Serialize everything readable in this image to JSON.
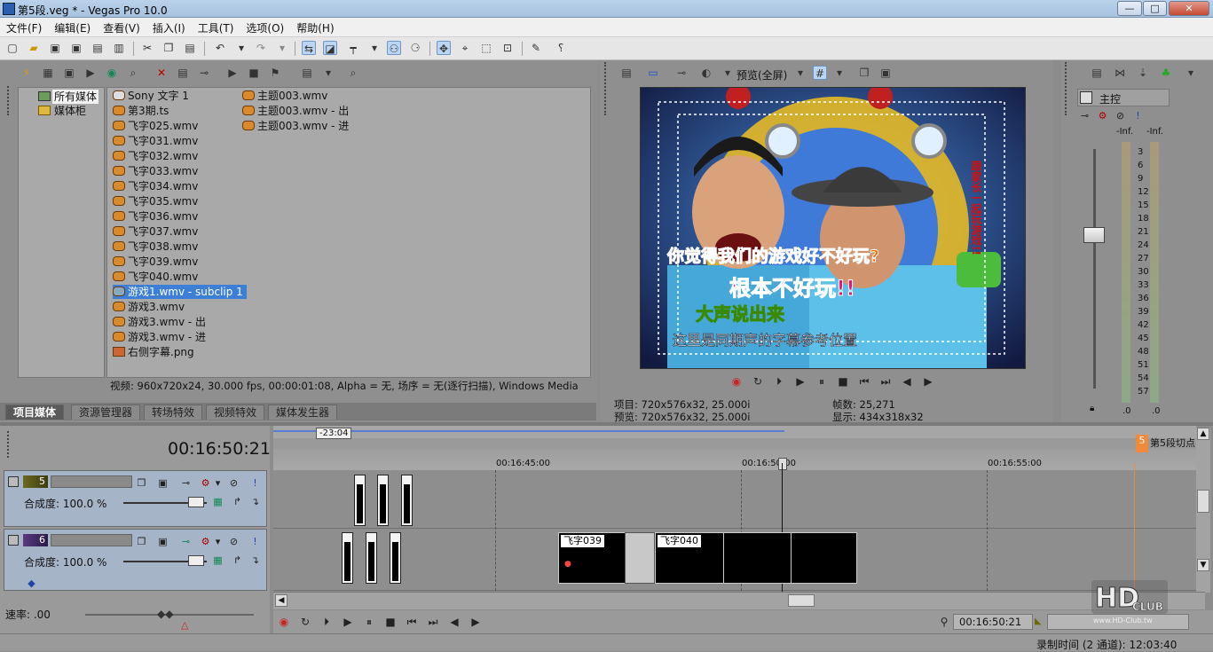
{
  "window": {
    "title": "第5段.veg * - Vegas Pro 10.0",
    "minimize": "—",
    "maximize": "□",
    "close": "✕"
  },
  "menu": [
    "文件(F)",
    "编辑(E)",
    "查看(V)",
    "插入(I)",
    "工具(T)",
    "选项(O)",
    "帮助(H)"
  ],
  "explorer": {
    "tree": [
      {
        "label": "所有媒体",
        "selected": true
      },
      {
        "label": "媒体柜",
        "selected": false
      }
    ],
    "col1": [
      "Sony 文字 1",
      "第3期.ts",
      "飞字025.wmv",
      "飞字031.wmv",
      "飞字032.wmv",
      "飞字033.wmv",
      "飞字034.wmv",
      "飞字035.wmv",
      "飞字036.wmv",
      "飞字037.wmv",
      "飞字038.wmv",
      "飞字039.wmv",
      "飞字040.wmv",
      "游戏1.wmv - subclip 1",
      "游戏3.wmv",
      "游戏3.wmv - 出",
      "游戏3.wmv - 进",
      "右侧字幕.png"
    ],
    "col2": [
      "主题003.wmv",
      "主题003.wmv - 出",
      "主题003.wmv - 进"
    ],
    "selected_item": "游戏1.wmv - subclip 1",
    "status": "视频: 960x720x24, 30.000 fps, 00:00:01:08, Alpha = 无, 场序 = 无(逐行扫描), Windows Media"
  },
  "tabs": [
    "项目媒体",
    "资源管理器",
    "转场特效",
    "视频特效",
    "媒体发生器"
  ],
  "preview": {
    "quality": "预览(全屏)",
    "overlay_text_1": "你觉得我们的游戏好不好玩?",
    "overlay_text_2": "根本不好玩!!",
    "overlay_text_3": "大声说出来",
    "overlay_text_4": "这里是同期声的字幕参考位置",
    "overlay_text_side": "跟家长一起玩游戏!!",
    "info": {
      "project": "项目: 720x576x32, 25.000i",
      "preview": "预览: 720x576x32, 25.000i",
      "frame": "帧数: 25,271",
      "display": "显示: 434x318x32"
    }
  },
  "mixer": {
    "title": "主控",
    "left_peak": "-Inf.",
    "right_peak": "-Inf.",
    "scale": [
      "3",
      "6",
      "9",
      "12",
      "15",
      "18",
      "21",
      "24",
      "27",
      "30",
      "33",
      "36",
      "39",
      "42",
      "45",
      "48",
      "51",
      "54",
      "57"
    ],
    "left_value": ".0",
    "right_value": ".0"
  },
  "timeline": {
    "cursor_time": "00:16:50:21",
    "loop_label": "-23:04",
    "ruler_labels": [
      "00:16:45:00",
      "00:16:50:00",
      "00:16:55:00"
    ],
    "marker_number": "5",
    "marker_label": "第5段切点",
    "tracks": [
      {
        "number": "5",
        "composite": "合成度: 100.0 %"
      },
      {
        "number": "6",
        "composite": "合成度: 100.0 %"
      }
    ],
    "events": [
      "飞字039",
      "飞字040"
    ],
    "rate": "速率: .00",
    "transport_time": "00:16:50:21"
  },
  "status": {
    "record_time": "录制时间 (2 通道): 12:03:40"
  },
  "watermark": {
    "brand": "HD CLUB",
    "url": "www.HD-Club.tw"
  }
}
